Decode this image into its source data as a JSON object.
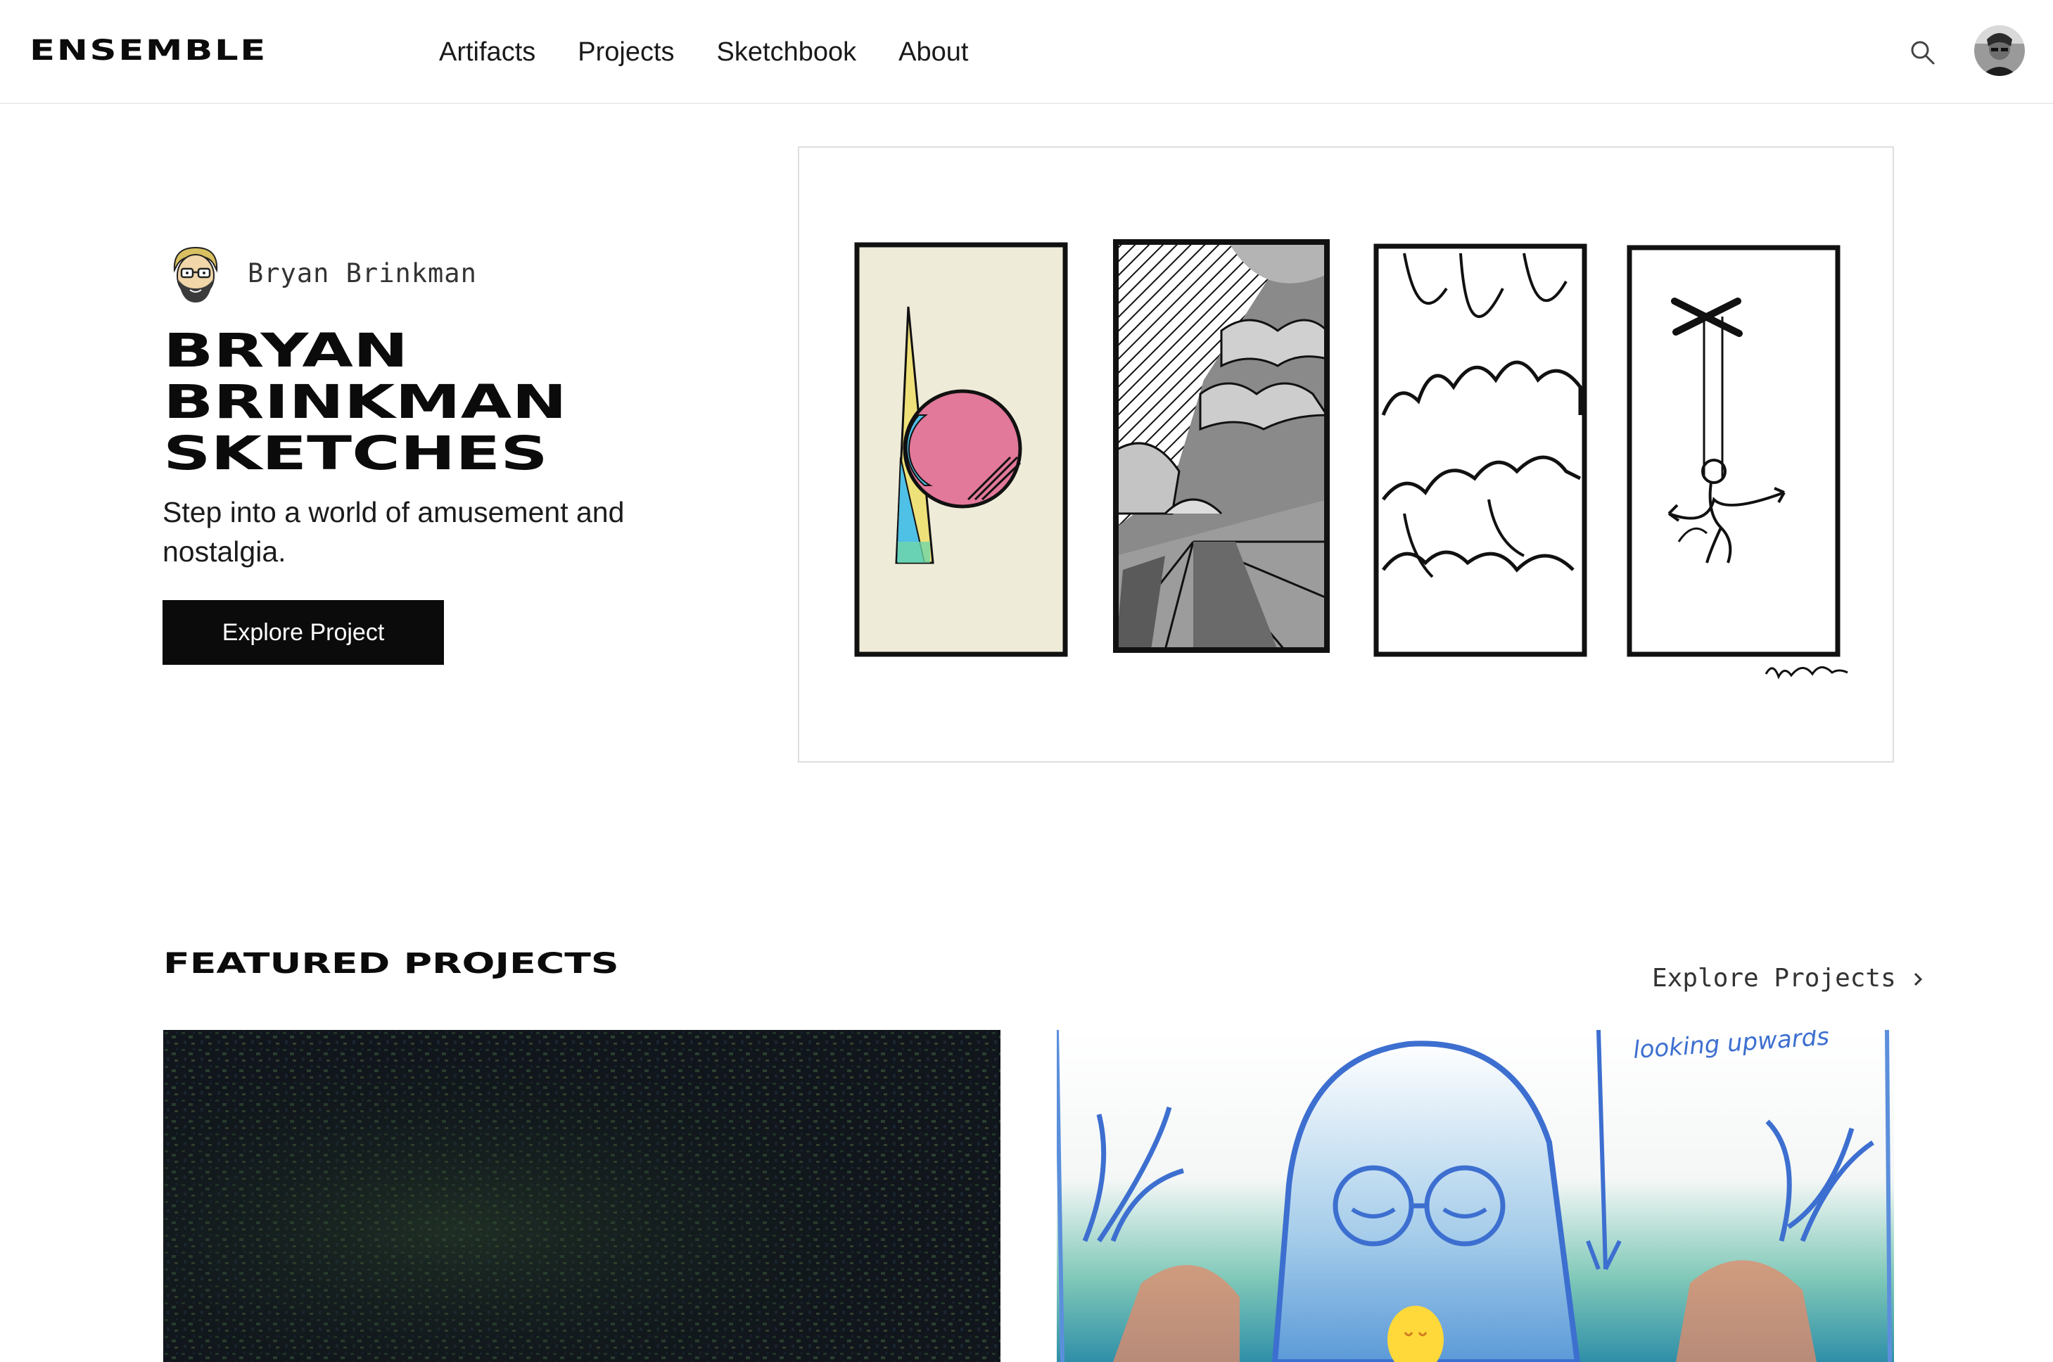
{
  "header": {
    "logo": "ENSEMBLE",
    "nav": [
      "Artifacts",
      "Projects",
      "Sketchbook",
      "About"
    ],
    "search_icon": "search-icon",
    "avatar_icon": "user-avatar"
  },
  "hero": {
    "author": "Bryan Brinkman",
    "title_lines": [
      "BRYAN",
      "BRINKMAN",
      "SKETCHES"
    ],
    "subtitle": "Step into a world of amusement and nostalgia.",
    "cta": "Explore Project",
    "artwork": {
      "panel_count": 4,
      "panel_colors": {
        "cream": "#efebd9",
        "pink": "#e2789a",
        "cyan": "#4fc0e6",
        "yellow": "#efe17a"
      }
    }
  },
  "featured": {
    "heading": "FEATURED PROJECTS",
    "explore_label": "Explore Projects",
    "explore_icon": "chevron-right-icon",
    "cards": [
      {
        "thumb_icon": "dark-textured-artwork"
      },
      {
        "thumb_icon": "blue-sketch-artwork",
        "handwriting": "looking upwards"
      }
    ]
  },
  "colors": {
    "text": "#111111",
    "button_bg": "#0b0b0b",
    "button_text": "#ffffff",
    "divider": "#ececec"
  }
}
